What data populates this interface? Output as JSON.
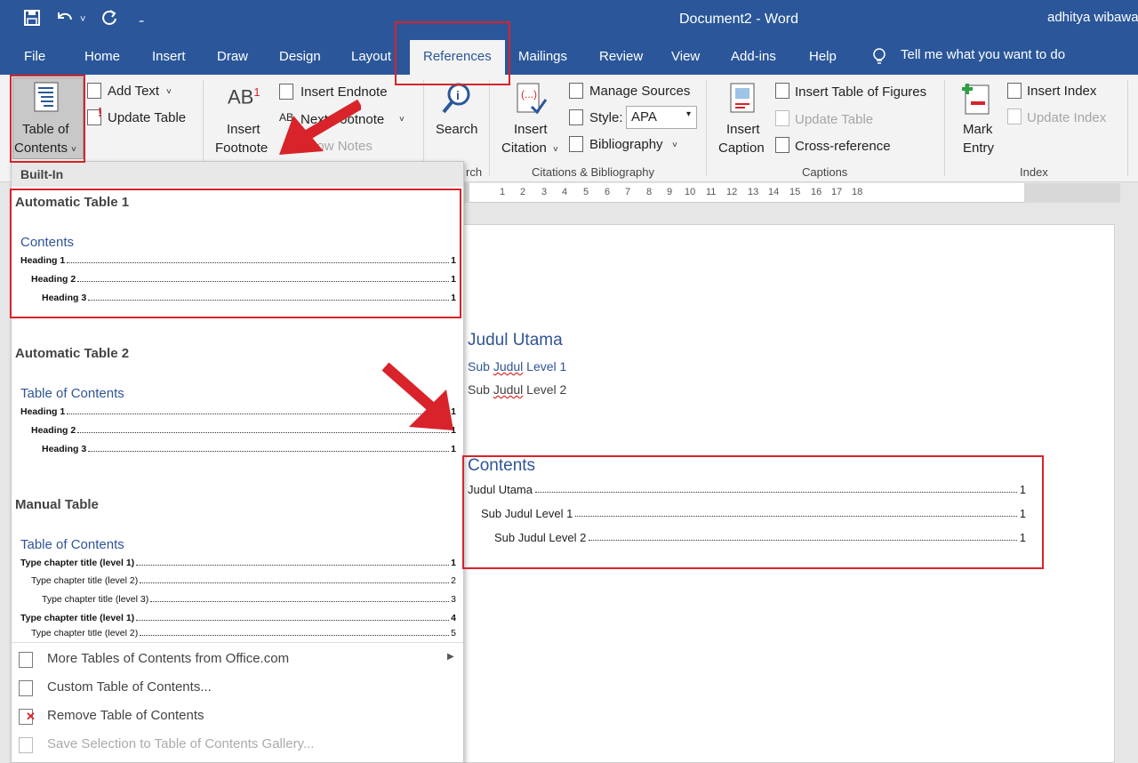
{
  "titlebar": {
    "document_title": "Document2  -  Word",
    "user_name": "adhitya wibawa",
    "qat": {
      "save_icon": "save-icon",
      "undo_icon": "undo-icon",
      "redo_icon": "redo-icon",
      "customize_icon": "customize-qat-icon"
    }
  },
  "tabs": [
    "File",
    "Home",
    "Insert",
    "Draw",
    "Design",
    "Layout",
    "References",
    "Mailings",
    "Review",
    "View",
    "Add-ins",
    "Help"
  ],
  "active_tab": "References",
  "tell_me": "Tell me what you want to do",
  "ribbon": {
    "toc": {
      "line1": "Table of",
      "line2": "Contents",
      "add_text": "Add Text",
      "update_table": "Update Table"
    },
    "footnotes": {
      "insert_line1": "Insert",
      "insert_line2": "Footnote",
      "insert_endnote": "Insert Endnote",
      "next_footnote": "Next Footnote",
      "show_notes": "Show Notes"
    },
    "research": {
      "search": "Search",
      "group_label": "rch"
    },
    "citations": {
      "insert_line1": "Insert",
      "insert_line2": "Citation",
      "manage_sources": "Manage Sources",
      "style_label": "Style:",
      "style_value": "APA",
      "bibliography": "Bibliography",
      "group_label": "Citations & Bibliography"
    },
    "captions": {
      "insert_line1": "Insert",
      "insert_line2": "Caption",
      "insert_tof": "Insert Table of Figures",
      "update_table": "Update Table",
      "cross_reference": "Cross-reference",
      "group_label": "Captions"
    },
    "index": {
      "mark_line1": "Mark",
      "mark_line2": "Entry",
      "insert_index": "Insert Index",
      "update_index": "Update Index",
      "group_label": "Index"
    }
  },
  "ruler_marks": [
    "1",
    "2",
    "3",
    "4",
    "5",
    "6",
    "7",
    "8",
    "9",
    "10",
    "11",
    "12",
    "13",
    "14",
    "15",
    "16",
    "17",
    "18"
  ],
  "document": {
    "heading_main": "Judul Utama",
    "heading_sub1_a": "Sub ",
    "heading_sub1_b": "Judul",
    "heading_sub1_c": " Level 1",
    "heading_sub2_a": "Sub ",
    "heading_sub2_b": "Judul",
    "heading_sub2_c": " Level 2",
    "toc_title": "Contents",
    "toc_rows": [
      {
        "text": "Judul Utama",
        "page": "1"
      },
      {
        "text": "Sub Judul Level 1",
        "page": "1"
      },
      {
        "text": "Sub Judul Level 2",
        "page": "1"
      }
    ]
  },
  "toc_menu": {
    "section_label": "Built-In",
    "auto1": {
      "title": "Automatic Table 1",
      "contents_title": "Contents",
      "rows": [
        {
          "text": "Heading 1",
          "page": "1"
        },
        {
          "text": "Heading 2",
          "page": "1"
        },
        {
          "text": "Heading 3",
          "page": "1"
        }
      ]
    },
    "auto2": {
      "title": "Automatic Table 2",
      "contents_title": "Table of Contents",
      "rows": [
        {
          "text": "Heading 1",
          "page": "1"
        },
        {
          "text": "Heading 2",
          "page": "1"
        },
        {
          "text": "Heading 3",
          "page": "1"
        }
      ]
    },
    "manual": {
      "title": "Manual Table",
      "contents_title": "Table of Contents",
      "rows": [
        {
          "text": "Type chapter title (level 1)",
          "page": "1"
        },
        {
          "text": "Type chapter title (level 2)",
          "page": "2"
        },
        {
          "text": "Type chapter title (level 3)",
          "page": "3"
        },
        {
          "text": "Type chapter title (level 1)",
          "page": "4"
        },
        {
          "text": "Type chapter title (level 2)",
          "page": "5"
        }
      ]
    },
    "more_tables": "More Tables of Contents from Office.com",
    "custom": "Custom Table of Contents...",
    "remove": "Remove Table of Contents",
    "save_selection": "Save Selection to Table of Contents Gallery..."
  },
  "colors": {
    "titlebar": "#2b579a",
    "annotation_red": "#d8232a",
    "heading_blue": "#2f5496"
  }
}
